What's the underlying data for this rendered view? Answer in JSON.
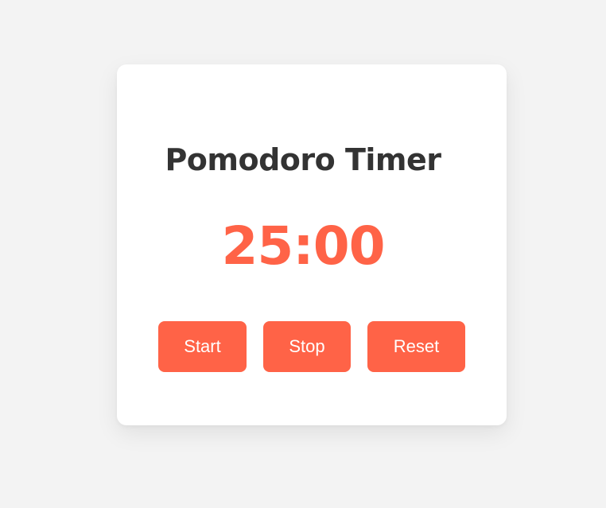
{
  "app": {
    "title": "Pomodoro Timer",
    "time_display": "25:00"
  },
  "controls": {
    "start_label": "Start",
    "stop_label": "Stop",
    "reset_label": "Reset"
  },
  "colors": {
    "accent": "#ff6347",
    "background": "#f3f3f3",
    "card": "#ffffff",
    "title_text": "#333333",
    "button_text": "#ffffff"
  }
}
